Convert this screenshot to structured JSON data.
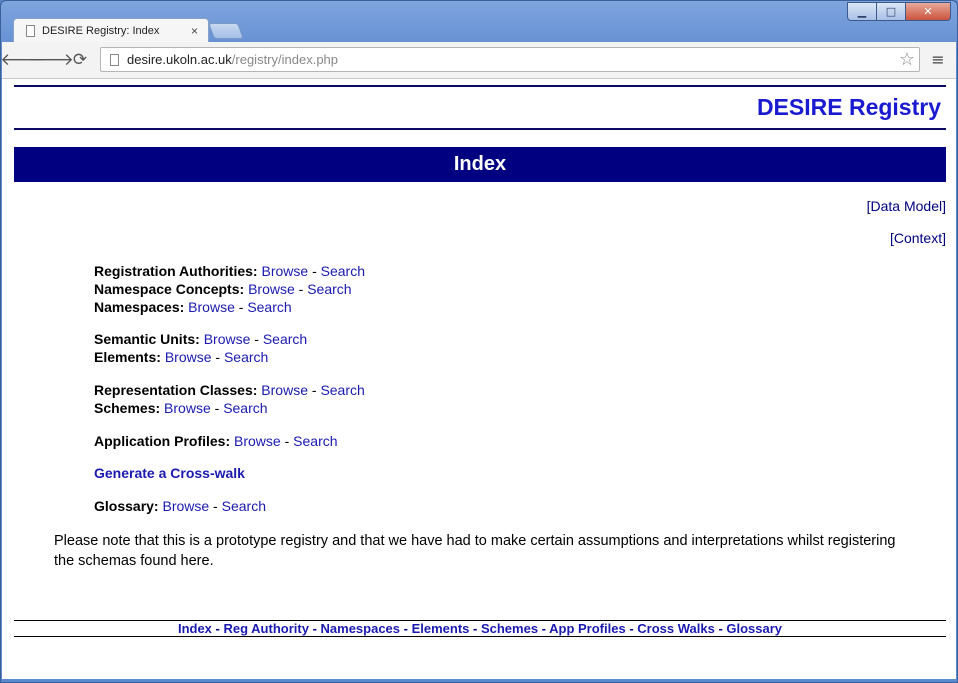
{
  "browser": {
    "tab_title": "DESIRE Registry: Index",
    "tab_close": "×",
    "url_host": "desire.ukoln.ac.uk",
    "url_path": "/registry/index.php",
    "back_icon": "🡐",
    "forward_icon": "🡒",
    "reload_icon": "⟳",
    "star_icon": "☆",
    "menu_icon": "≡",
    "min_icon": "▁",
    "max_icon": "□",
    "close_icon": "✕"
  },
  "page": {
    "brand": "DESIRE Registry",
    "banner": "Index",
    "data_model": "[Data Model]",
    "context": "[Context]",
    "browse": "Browse",
    "search": "Search",
    "sep": " - ",
    "rows": {
      "reg_auth": "Registration Authorities:",
      "ns_concepts": "Namespace Concepts:",
      "namespaces": "Namespaces:",
      "semantic_units": "Semantic Units:",
      "elements": "Elements:",
      "rep_classes": "Representation Classes:",
      "schemes": "Schemes:",
      "app_profiles": "Application Profiles:",
      "crosswalk": "Generate a Cross-walk",
      "glossary": "Glossary:"
    },
    "note": "Please note that this is a prototype registry and that we have had to make certain assumptions and interpretations whilst registering the schemas found here."
  },
  "footer": {
    "links": [
      "Index",
      "Reg Authority",
      "Namespaces",
      "Elements",
      "Schemes",
      "App Profiles",
      "Cross Walks",
      "Glossary"
    ],
    "sep": " - "
  }
}
